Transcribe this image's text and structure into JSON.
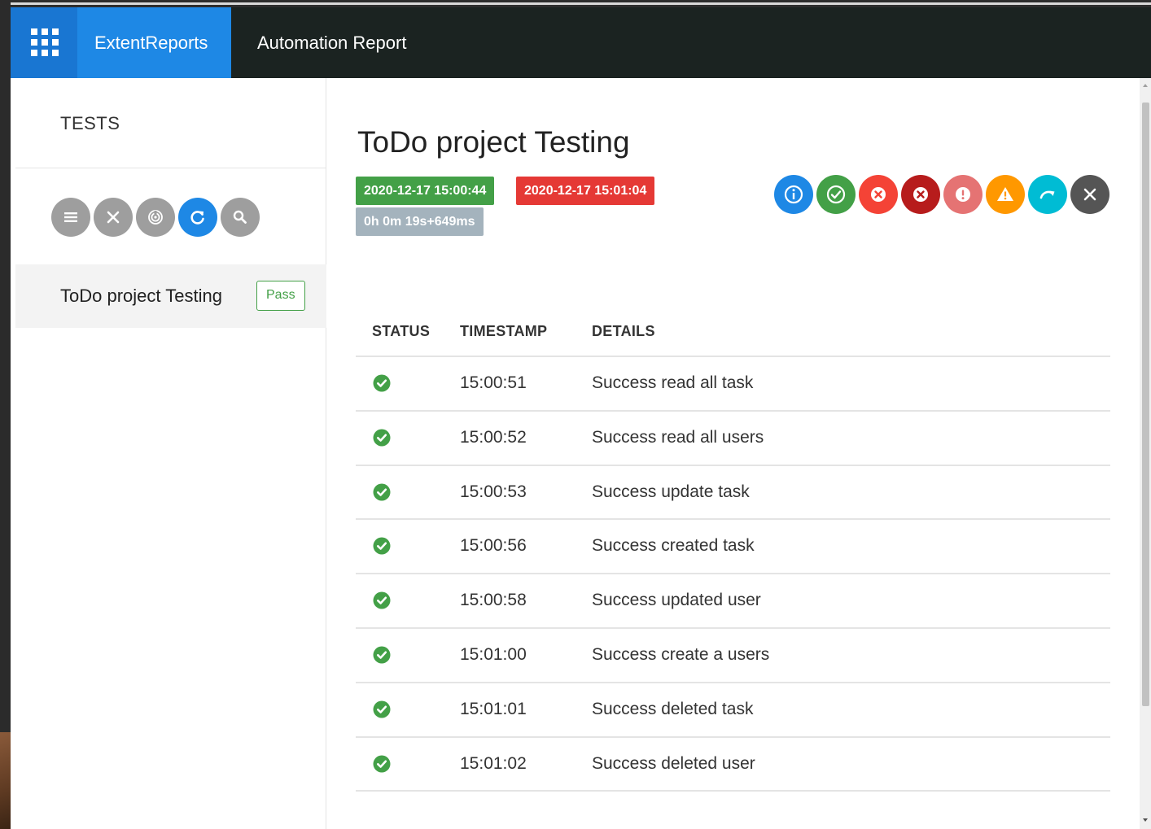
{
  "topbar": {
    "brand": "ExtentReports",
    "report_name": "Automation Report"
  },
  "sidebar": {
    "title": "TESTS",
    "filter_icons": [
      "list-icon",
      "close-icon",
      "fingerprint-icon",
      "refresh-icon",
      "search-icon"
    ],
    "tests": [
      {
        "name": "ToDo project Testing",
        "status": "Pass"
      }
    ]
  },
  "main": {
    "title": "ToDo project Testing",
    "start_time": "2020-12-17 15:00:44",
    "end_time": "2020-12-17 15:01:04",
    "duration": "0h 0m 19s+649ms",
    "status_filters": [
      {
        "icon": "info-icon",
        "color": "#1e88e5"
      },
      {
        "icon": "check-icon",
        "color": "#43a047"
      },
      {
        "icon": "fail-icon",
        "color": "#f44336"
      },
      {
        "icon": "fatal-icon",
        "color": "#b71c1c"
      },
      {
        "icon": "error-icon",
        "color": "#e57373"
      },
      {
        "icon": "warning-icon",
        "color": "#ff9800"
      },
      {
        "icon": "skip-icon",
        "color": "#00bcd4"
      },
      {
        "icon": "clear-icon",
        "color": "#555555"
      }
    ],
    "table": {
      "headers": {
        "status": "STATUS",
        "timestamp": "TIMESTAMP",
        "details": "DETAILS"
      },
      "rows": [
        {
          "status": "pass",
          "timestamp": "15:00:51",
          "details": "Success read all task"
        },
        {
          "status": "pass",
          "timestamp": "15:00:52",
          "details": "Success read all users"
        },
        {
          "status": "pass",
          "timestamp": "15:00:53",
          "details": "Success update task"
        },
        {
          "status": "pass",
          "timestamp": "15:00:56",
          "details": "Success created task"
        },
        {
          "status": "pass",
          "timestamp": "15:00:58",
          "details": "Success updated user"
        },
        {
          "status": "pass",
          "timestamp": "15:01:00",
          "details": "Success create a users"
        },
        {
          "status": "pass",
          "timestamp": "15:01:01",
          "details": "Success deleted task"
        },
        {
          "status": "pass",
          "timestamp": "15:01:02",
          "details": "Success deleted user"
        }
      ]
    }
  },
  "colors": {
    "nav_dark": "#1b2321",
    "brand_blue": "#1e88e5",
    "pass_green": "#43a047",
    "fail_red": "#e53935",
    "duration_grey": "#a4b3bd"
  }
}
